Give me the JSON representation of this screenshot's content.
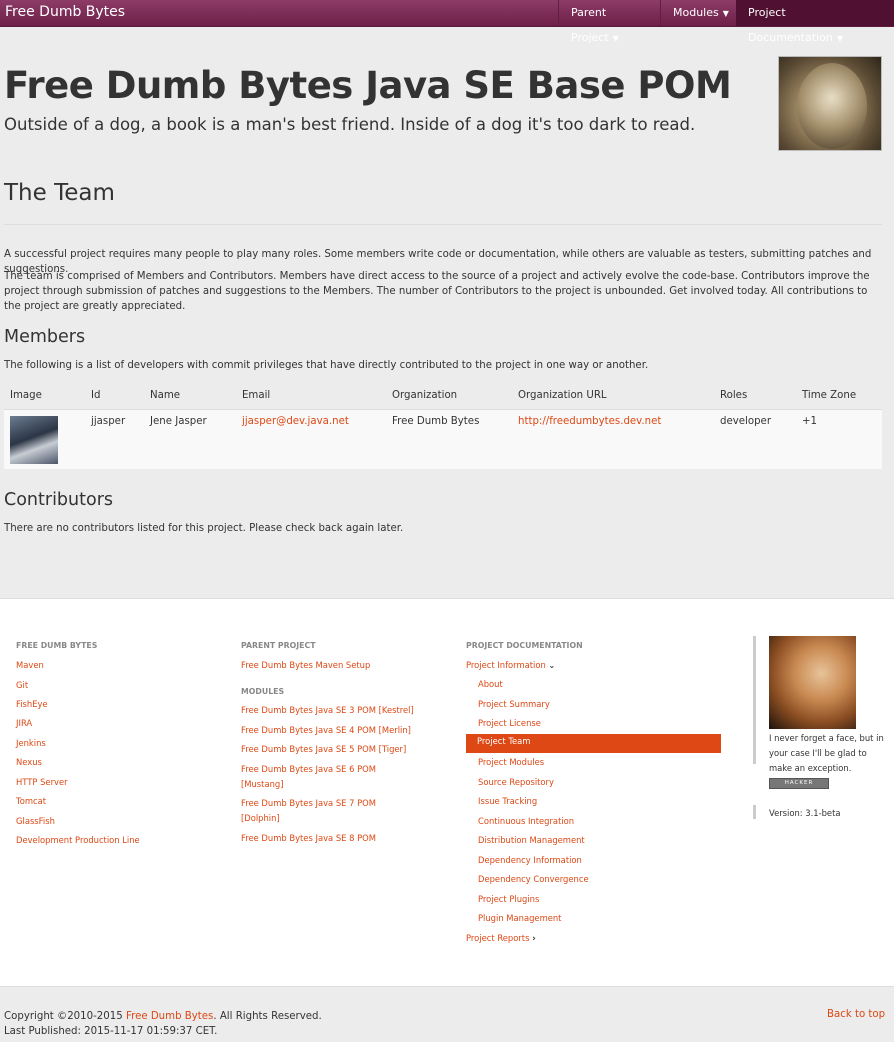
{
  "nav": {
    "brand": "Free Dumb Bytes",
    "items": [
      "Parent Project",
      "Modules",
      "Project Documentation"
    ]
  },
  "header": {
    "title": "Free Dumb Bytes Java SE Base POM",
    "tagline": "Outside of a dog, a book is a man's best friend. Inside of a dog it's too dark to read."
  },
  "team": {
    "heading": "The Team",
    "para1": "A successful project requires many people to play many roles. Some members write code or documentation, while others are valuable as testers, submitting patches and suggestions.",
    "para2": "The team is comprised of Members and Contributors. Members have direct access to the source of a project and actively evolve the code-base. Contributors improve the project through submission of patches and suggestions to the Members. The number of Contributors to the project is unbounded. Get involved today. All contributions to the project are greatly appreciated."
  },
  "members": {
    "heading": "Members",
    "intro": "The following is a list of developers with commit privileges that have directly contributed to the project in one way or another.",
    "columns": [
      "Image",
      "Id",
      "Name",
      "Email",
      "Organization",
      "Organization URL",
      "Roles",
      "Time Zone"
    ],
    "rows": [
      {
        "id": "jjasper",
        "name": "Jene Jasper",
        "email": "jjasper@dev.java.net",
        "organization": "Free Dumb Bytes",
        "organization_url": "http://freedumbytes.dev.net",
        "roles": "developer",
        "timezone": "+1"
      }
    ]
  },
  "contributors": {
    "heading": "Contributors",
    "text": "There are no contributors listed for this project. Please check back again later."
  },
  "footer": {
    "col1": {
      "heading": "Free Dumb Bytes",
      "links": [
        "Maven",
        "Git",
        "FishEye",
        "JIRA",
        "Jenkins",
        "Nexus",
        "HTTP Server",
        "Tomcat",
        "GlassFish",
        "Development Production Line"
      ]
    },
    "col2": {
      "heading": "Parent Project",
      "links": [
        "Free Dumb Bytes Maven Setup"
      ],
      "modules_heading": "Modules",
      "modules": [
        "Free Dumb Bytes Java SE 3 POM [Kestrel]",
        "Free Dumb Bytes Java SE 4 POM [Merlin]",
        "Free Dumb Bytes Java SE 5 POM [Tiger]",
        "Free Dumb Bytes Java SE 6 POM",
        "[Mustang]",
        "Free Dumb Bytes Java SE 7 POM",
        "[Dolphin]",
        "Free Dumb Bytes Java SE 8 POM"
      ]
    },
    "col3": {
      "heading": "Project Documentation",
      "project_info": "Project Information",
      "items": [
        "About",
        "Project Summary",
        "Project License",
        "Project Team",
        "Project Modules",
        "Source Repository",
        "Issue Tracking",
        "Continuous Integration",
        "Distribution Management",
        "Dependency Information",
        "Dependency Convergence",
        "Project Plugins",
        "Plugin Management"
      ],
      "active": "Project Team",
      "project_reports": "Project Reports"
    },
    "col4": {
      "quote": "I never forget a face, but in your case I'll be glad to make an exception.",
      "badge": "HACKER",
      "version": "Version: 3.1-beta"
    }
  },
  "bottom": {
    "copyright_prefix": "Copyright ©2010-2015 ",
    "copyright_link": "Free Dumb Bytes",
    "copyright_suffix": ". All Rights Reserved.",
    "published": "Last Published: 2015-11-17 01:59:37 CET.",
    "back_to_top": "Back to top"
  },
  "colors": {
    "navbar": "#772953",
    "accent": "#dd4814",
    "background": "#ececec"
  }
}
